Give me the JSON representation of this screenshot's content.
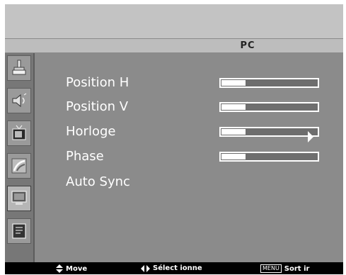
{
  "header": {
    "title": "PC"
  },
  "sidebar": {
    "items": [
      {
        "icon": "brush-icon",
        "active": false
      },
      {
        "icon": "speaker-icon",
        "active": false
      },
      {
        "icon": "tv-icon",
        "active": false
      },
      {
        "icon": "signal-icon",
        "active": false
      },
      {
        "icon": "monitor-icon",
        "active": true
      },
      {
        "icon": "info-panel-icon",
        "active": false
      }
    ]
  },
  "menu": {
    "items": [
      {
        "label": "Position H",
        "level": 0.25
      },
      {
        "label": "Position V",
        "level": 0.25
      },
      {
        "label": "Horloge",
        "level": 0.25
      },
      {
        "label": "Phase",
        "level": 0.25
      },
      {
        "label": "Auto Sync"
      }
    ]
  },
  "footer": {
    "move_label": "Move",
    "select_label": "Sélect ionne",
    "menu_key": "MENU",
    "exit_label": "Sort ir"
  }
}
